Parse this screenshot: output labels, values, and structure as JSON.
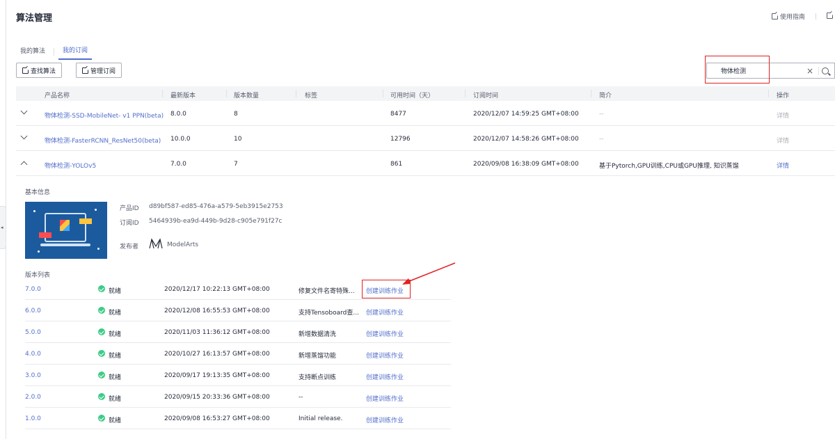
{
  "header": {
    "title": "算法管理",
    "guide_label": "使用指南",
    "secondary_label": ""
  },
  "tabs": [
    {
      "label": "我的算法"
    },
    {
      "label": "我的订阅"
    }
  ],
  "toolbar": {
    "find_label": "查找算法",
    "manage_label": "管理订阅"
  },
  "search": {
    "value": "物体检测"
  },
  "table": {
    "columns": [
      "产品名称",
      "最新版本",
      "版本数量",
      "标签",
      "可用时间（天）",
      "订阅时间",
      "简介",
      "操作"
    ],
    "rows": [
      {
        "name": "物体检测-SSD-MobileNet- v1 PPN(beta)",
        "latest": "8.0.0",
        "count": "8",
        "tag": "",
        "days": "8477",
        "time": "2020/12/07 14:59:25 GMT+08:00",
        "desc": "--",
        "action": "详情"
      },
      {
        "name": "物体检测-FasterRCNN_ResNet50(beta)",
        "latest": "10.0.0",
        "count": "10",
        "tag": "",
        "days": "12796",
        "time": "2020/12/07 14:58:26 GMT+08:00",
        "desc": "--",
        "action": "详情"
      },
      {
        "name": "物体检测-YOLOv5",
        "latest": "7.0.0",
        "count": "7",
        "tag": "",
        "days": "861",
        "time": "2020/09/08 16:38:09 GMT+08:00",
        "desc": "基于Pytorch,GPU训练,CPU或GPU推理, 知识蒸馏",
        "action": "详情"
      }
    ]
  },
  "detail": {
    "basic_title": "基本信息",
    "product_id_label": "产品ID",
    "product_id": "d89bf587-ed85-476a-a579-5eb3915e2753",
    "sub_id_label": "订阅ID",
    "sub_id": "5464939b-ea9d-449b-9d28-c905e791f27c",
    "publisher_label": "发布者",
    "publisher": "ModelArts",
    "versions_title": "版本列表",
    "versions": [
      {
        "version": "7.0.0",
        "status": "就绪",
        "time": "2020/12/17 10:22:13 GMT+08:00",
        "note": "修复文件名寄特殊...",
        "action": "创建训练作业"
      },
      {
        "version": "6.0.0",
        "status": "就绪",
        "time": "2020/12/08 16:55:53 GMT+08:00",
        "note": "支持Tensoboard查...",
        "action": "创建训练作业"
      },
      {
        "version": "5.0.0",
        "status": "就绪",
        "time": "2020/11/03 11:36:12 GMT+08:00",
        "note": "新增数据清洗",
        "action": "创建训练作业"
      },
      {
        "version": "4.0.0",
        "status": "就绪",
        "time": "2020/10/27 16:13:57 GMT+08:00",
        "note": "新增蒸馏功能",
        "action": "创建训练作业"
      },
      {
        "version": "3.0.0",
        "status": "就绪",
        "time": "2020/09/17 19:13:35 GMT+08:00",
        "note": "支持断点训练",
        "action": "创建训练作业"
      },
      {
        "version": "2.0.0",
        "status": "就绪",
        "time": "2020/09/15 20:33:36 GMT+08:00",
        "note": "--",
        "action": "创建训练作业"
      },
      {
        "version": "1.0.0",
        "status": "就绪",
        "time": "2020/09/08 16:53:27 GMT+08:00",
        "note": "Initial release.",
        "action": "创建训练作业"
      }
    ]
  },
  "colors": {
    "link": "#526ecc",
    "success": "#3dcc87",
    "annotation": "#e02020"
  },
  "icons": [
    "edit-icon",
    "search-icon",
    "close-icon",
    "chevron-down-icon",
    "chevron-up-icon",
    "check-circle-icon",
    "modelarts-logo",
    "collapse-arrow-icon"
  ]
}
